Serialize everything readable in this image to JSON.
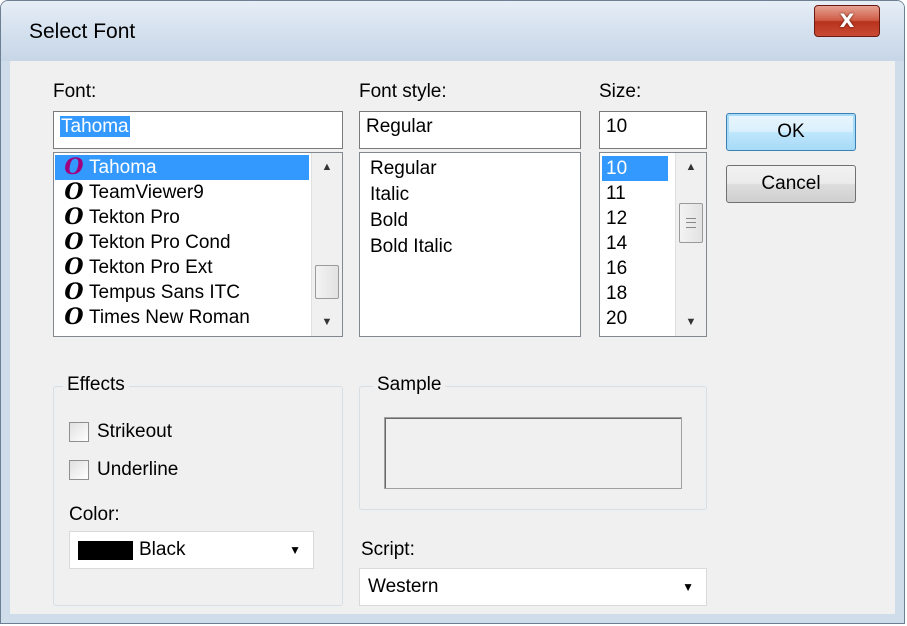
{
  "window": {
    "title": "Select Font",
    "close_label": "X"
  },
  "font": {
    "label": "Font:",
    "value": "Tahoma",
    "items": [
      "Tahoma",
      "TeamViewer9",
      "Tekton Pro",
      "Tekton Pro Cond",
      "Tekton Pro Ext",
      "Tempus Sans ITC",
      "Times New Roman"
    ],
    "item_glyph": "O"
  },
  "style": {
    "label": "Font style:",
    "value": "Regular",
    "items": [
      "Regular",
      "Italic",
      "Bold",
      "Bold Italic"
    ]
  },
  "size": {
    "label": "Size:",
    "value": "10",
    "items": [
      "10",
      "11",
      "12",
      "14",
      "16",
      "18",
      "20"
    ]
  },
  "buttons": {
    "ok": "OK",
    "cancel": "Cancel"
  },
  "effects": {
    "label": "Effects",
    "strikeout": "Strikeout",
    "underline": "Underline",
    "color_label": "Color:",
    "color_value": "Black",
    "color_swatch": "#000000"
  },
  "sample": {
    "label": "Sample"
  },
  "script": {
    "label": "Script:",
    "value": "Western"
  },
  "colors": {
    "selection": "#3399ff",
    "font_icon_selected": "#a0007e"
  }
}
